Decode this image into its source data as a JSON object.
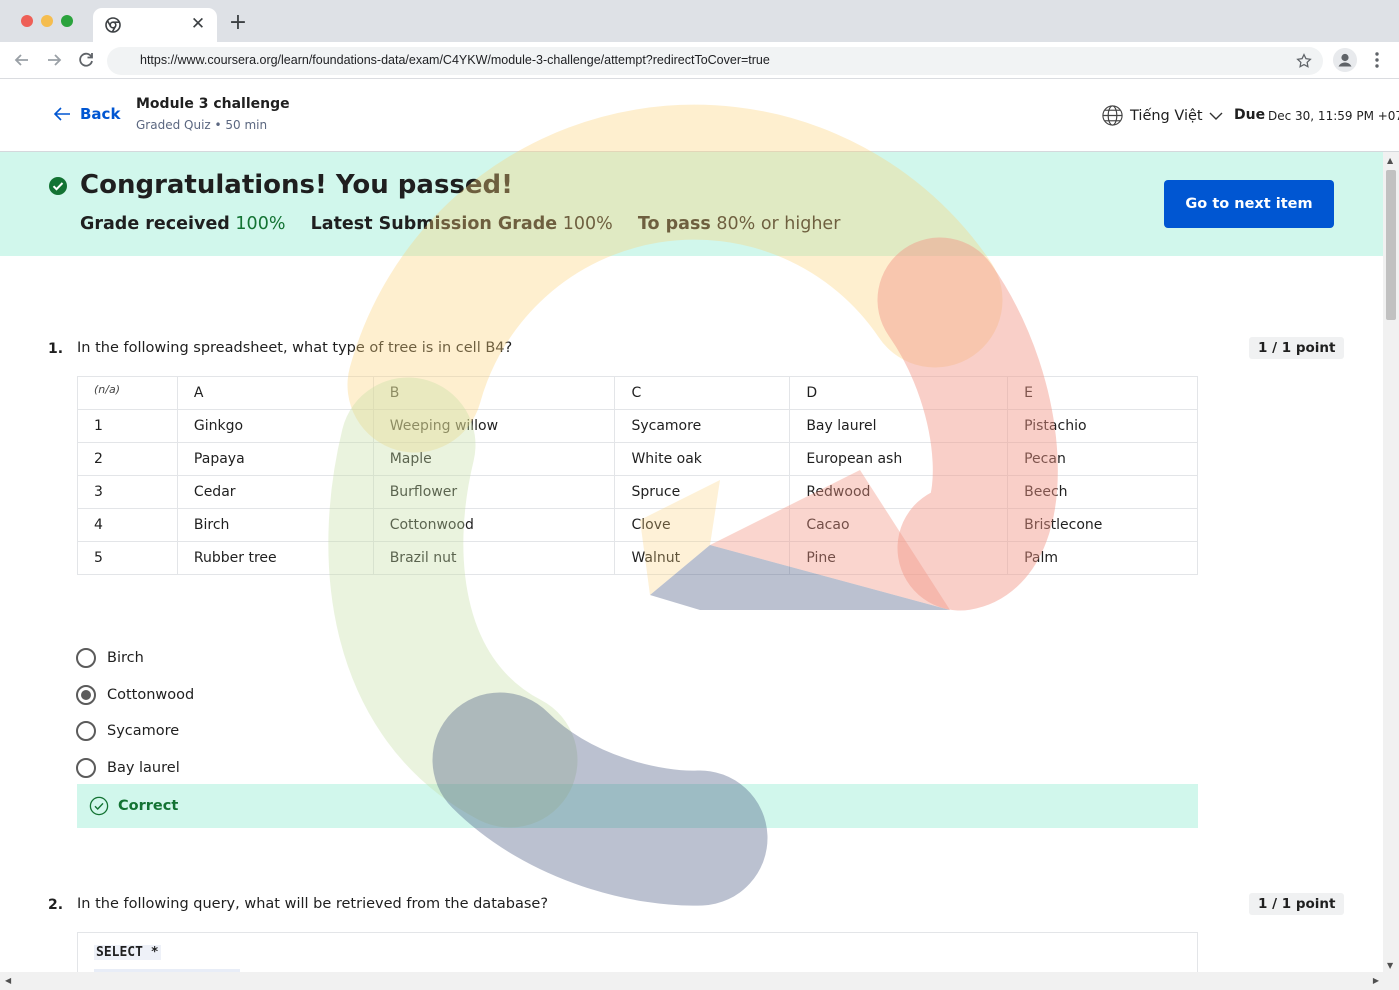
{
  "browser": {
    "url": "https://www.coursera.org/learn/foundations-data/exam/C4YKW/module-3-challenge/attempt?redirectToCover=true",
    "tab_close": "✕",
    "new_tab": "+"
  },
  "header": {
    "back_label": "Back",
    "title": "Module 3 challenge",
    "subtitle": "Graded Quiz • 50 min",
    "language": "Tiếng Việt",
    "due_label": "Due",
    "due_value": "Dec 30, 11:59 PM +07"
  },
  "banner": {
    "title": "Congratulations! You passed!",
    "grade_received_label": "Grade received",
    "grade_received_value": "100%",
    "latest_label": "Latest Submission Grade",
    "latest_value": "100%",
    "pass_label": "To pass",
    "pass_value": "80% or higher",
    "next_button": "Go to next item"
  },
  "q1": {
    "number": "1.",
    "text": "In the following spreadsheet, what type of tree is in cell B4?",
    "points": "1 / 1 point",
    "table": {
      "corner": "(n/a)",
      "columns": [
        "A",
        "B",
        "C",
        "D",
        "E"
      ],
      "rows": [
        [
          "1",
          "Ginkgo",
          "Weeping willow",
          "Sycamore",
          "Bay laurel",
          "Pistachio"
        ],
        [
          "2",
          "Papaya",
          "Maple",
          "White oak",
          "European ash",
          "Pecan"
        ],
        [
          "3",
          "Cedar",
          "Burflower",
          "Spruce",
          "Redwood",
          "Beech"
        ],
        [
          "4",
          "Birch",
          "Cottonwood",
          "Clove",
          "Cacao",
          "Bristlecone"
        ],
        [
          "5",
          "Rubber tree",
          "Brazil nut",
          "Walnut",
          "Pine",
          "Palm"
        ]
      ]
    },
    "options": [
      "Birch",
      "Cottonwood",
      "Sycamore",
      "Bay laurel"
    ],
    "selected_index": 1,
    "feedback": "Correct"
  },
  "q2": {
    "number": "2.",
    "text": "In the following query, what will be retrieved from the database?",
    "points": "1 / 1 point",
    "code": "SELECT *"
  },
  "colors": {
    "accent": "#0056d2",
    "success_bg": "#d1f7ec",
    "success_text": "#137333"
  },
  "icons": [
    "globe-icon",
    "check-circle-icon",
    "back-arrow-icon",
    "chevron-down-icon",
    "star-icon",
    "profile-icon",
    "menu-dots-icon"
  ]
}
